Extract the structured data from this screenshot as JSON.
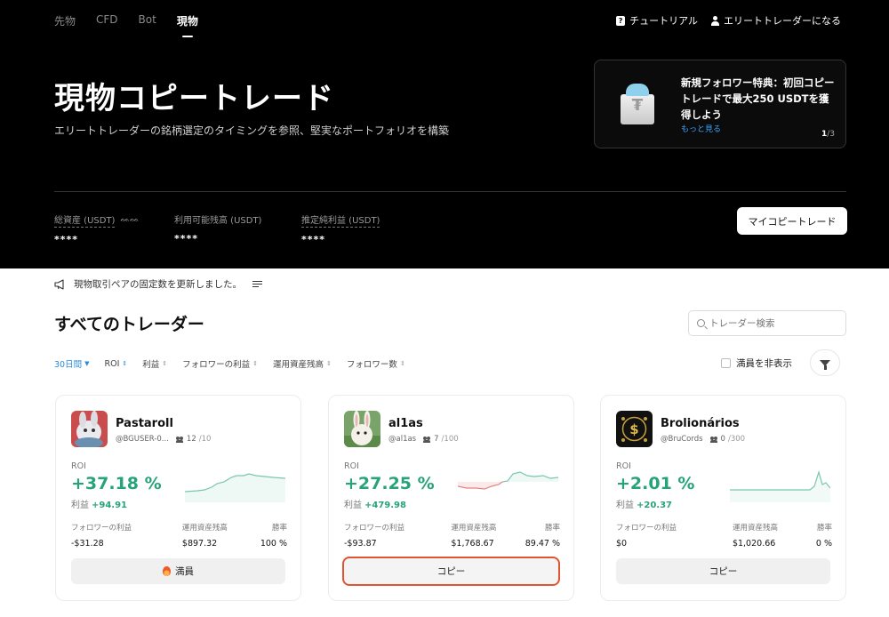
{
  "nav": {
    "tabs": [
      "先物",
      "CFD",
      "Bot",
      "現物"
    ],
    "tutorial": "チュートリアル",
    "become_trader": "エリートトレーダーになる"
  },
  "hero": {
    "title": "現物コピートレード",
    "subtitle": "エリートトレーダーの銘柄選定のタイミングを参照、堅実なポートフォリオを構築"
  },
  "promo": {
    "text": "新規フォロワー特典：初回コピートレードで最大250 USDTを獲得しよう",
    "more": "もっと見る",
    "page_current": "1",
    "page_total": "/3"
  },
  "stats": {
    "total_assets_label": "総資産 (USDT)",
    "total_assets_value": "****",
    "available_label": "利用可能残高 (USDT)",
    "available_value": "****",
    "net_profit_label": "推定純利益 (USDT)",
    "net_profit_value": "****",
    "my_copy_button": "マイコピートレード"
  },
  "notice": "現物取引ペアの固定数を更新しました。",
  "section": {
    "title": "すべてのトレーダー",
    "search_placeholder": "トレーダー検索"
  },
  "filters": {
    "period": "30日間",
    "sorts": [
      "ROI",
      "利益",
      "フォロワーの利益",
      "運用資産残高",
      "フォロワー数"
    ],
    "hide_full": "満員を非表示"
  },
  "labels": {
    "roi": "ROI",
    "pnl": "利益",
    "follower_pnl": "フォロワーの利益",
    "aum": "運用資産残高",
    "win_rate": "勝率"
  },
  "colors": {
    "profit": "#27a37a",
    "accent": "#2a8bd6",
    "highlight": "#e0542f"
  },
  "traders": [
    {
      "name": "Pastaroll",
      "handle": "@BGUSER-0...",
      "followers": "12",
      "max_followers": "/10",
      "roi": "+37.18 %",
      "pnl": "+94.91",
      "follower_pnl": "-$31.28",
      "aum": "$897.32",
      "win_rate": "100 %",
      "button": "満員",
      "button_icon": "flame-icon",
      "avatar": "rabbit-avatar"
    },
    {
      "name": "al1as",
      "handle": "@al1as",
      "followers": "7",
      "max_followers": "/100",
      "roi": "+27.25 %",
      "pnl": "+479.98",
      "follower_pnl": "-$93.87",
      "aum": "$1,768.67",
      "win_rate": "89.47 %",
      "button": "コピー",
      "avatar": "bunny-avatar"
    },
    {
      "name": "Brolionários",
      "handle": "@BruCords",
      "followers": "0",
      "max_followers": "/300",
      "roi": "+2.01 %",
      "pnl": "+20.37",
      "follower_pnl": "$0",
      "aum": "$1,020.66",
      "win_rate": "0 %",
      "button": "コピー",
      "avatar": "money-avatar"
    }
  ]
}
